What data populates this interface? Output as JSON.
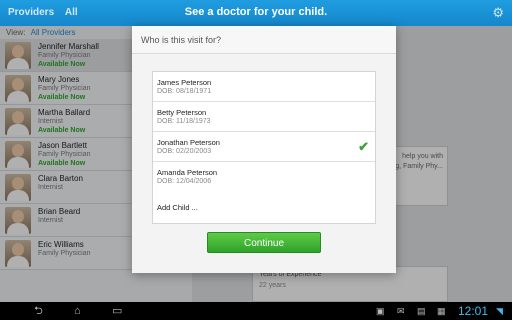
{
  "topbar": {
    "left_text": "Providers",
    "left_count": "All",
    "title": "See a doctor for your child."
  },
  "sidebar": {
    "view_label": "View:",
    "view_value": "All Providers",
    "providers": [
      {
        "name": "Jennifer Marshall",
        "role": "Family Physician",
        "status": "Available Now"
      },
      {
        "name": "Mary Jones",
        "role": "Family Physician",
        "status": "Available Now"
      },
      {
        "name": "Martha Ballard",
        "role": "Internist",
        "status": "Available Now"
      },
      {
        "name": "Jason Bartlett",
        "role": "Family Physician",
        "status": "Available Now"
      },
      {
        "name": "Clara Barton",
        "role": "Internist",
        "status": ""
      },
      {
        "name": "Brian Beard",
        "role": "Internist",
        "status": ""
      },
      {
        "name": "Eric Williams",
        "role": "Family Physician",
        "status": ""
      }
    ]
  },
  "background": {
    "card1_line1": "help you with",
    "card1_line2": "g, Family Phy...",
    "card2_label": "Years of Experience",
    "card2_value": "22 years"
  },
  "modal": {
    "question": "Who is this visit for?",
    "people": [
      {
        "name": "James Peterson",
        "dob": "DOB: 08/18/1971",
        "selected": false
      },
      {
        "name": "Betty Peterson",
        "dob": "DOB: 11/18/1973",
        "selected": false
      },
      {
        "name": "Jonathan Peterson",
        "dob": "DOB: 02/20/2003",
        "selected": true
      },
      {
        "name": "Amanda Peterson",
        "dob": "DOB: 12/04/2006",
        "selected": false
      }
    ],
    "add_child": "Add Child ...",
    "continue": "Continue",
    "check_icon": "✔"
  },
  "navbar": {
    "time": "12:01"
  }
}
